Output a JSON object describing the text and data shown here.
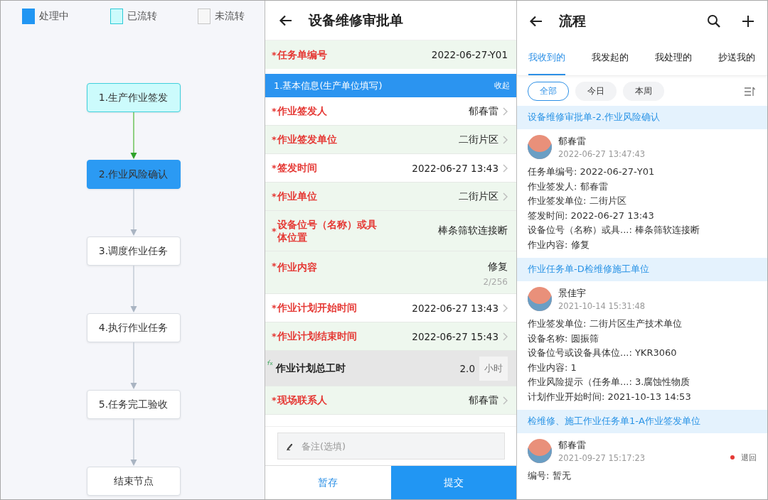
{
  "flow": {
    "legend": [
      {
        "label": "处理中",
        "kind": "active"
      },
      {
        "label": "已流转",
        "kind": "done"
      },
      {
        "label": "未流转",
        "kind": "pending"
      }
    ],
    "nodes": [
      {
        "label": "1.生产作业签发",
        "kind": "done"
      },
      {
        "label": "2.作业风险确认",
        "kind": "active"
      },
      {
        "label": "3.调度作业任务",
        "kind": "pending"
      },
      {
        "label": "4.执行作业任务",
        "kind": "pending"
      },
      {
        "label": "5.任务完工验收",
        "kind": "pending"
      },
      {
        "label": "结束节点",
        "kind": "pending"
      }
    ]
  },
  "form": {
    "title": "设备维修审批单",
    "task_number": {
      "marker": "*",
      "label": "任务单编号",
      "value": "2022-06-27-Y01"
    },
    "section": {
      "title": "1.基本信息(生产单位填写)",
      "action": "收起"
    },
    "fields": [
      {
        "kind": "select",
        "marker": "*",
        "label": "作业签发人",
        "value": "郁春雷",
        "shaded": false
      },
      {
        "kind": "select",
        "marker": "*",
        "label": "作业签发单位",
        "value": "二街片区",
        "shaded": true
      },
      {
        "kind": "select",
        "marker": "*",
        "label": "签发时间",
        "value": "2022-06-27 13:43",
        "shaded": false
      },
      {
        "kind": "select",
        "marker": "*",
        "label": "作业单位",
        "value": "二街片区",
        "shaded": true
      },
      {
        "kind": "text",
        "marker": "*",
        "label": "设备位号（名称）或具体位置",
        "value": "棒条筛软连接断",
        "shaded": true
      },
      {
        "kind": "text",
        "marker": "*",
        "label": "作业内容",
        "value": "修复",
        "counter": "2/256",
        "shaded": true
      },
      {
        "kind": "select",
        "marker": "*",
        "label": "作业计划开始时间",
        "value": "2022-06-27 13:43",
        "shaded": false
      },
      {
        "kind": "select",
        "marker": "*",
        "label": "作业计划结束时间",
        "value": "2022-06-27 15:43",
        "shaded": true
      },
      {
        "kind": "formula",
        "label": "作业计划总工时",
        "value": "2.0",
        "unit": "小时"
      },
      {
        "kind": "select",
        "marker": "*",
        "label": "现场联系人",
        "value": "郁春雷",
        "shaded": true
      }
    ],
    "remark": {
      "placeholder": "备注(选填)"
    },
    "buttons": [
      {
        "label": "暂存",
        "kind": "secondary"
      },
      {
        "label": "提交",
        "kind": "primary"
      }
    ]
  },
  "process": {
    "title": "流程",
    "tabs": [
      {
        "label": "我收到的",
        "selected": true
      },
      {
        "label": "我发起的",
        "selected": false
      },
      {
        "label": "我处理的",
        "selected": false
      },
      {
        "label": "抄送我的",
        "selected": false
      }
    ],
    "filters": [
      {
        "label": "全部",
        "selected": true
      },
      {
        "label": "今日",
        "selected": false
      },
      {
        "label": "本周",
        "selected": false
      }
    ],
    "items": [
      {
        "group": "设备维修审批单-2.作业风险确认",
        "name": "郁春雷",
        "time": "2022-06-27 13:47:43",
        "lines": [
          "任务单编号: 2022-06-27-Y01",
          "作业签发人: 郁春雷",
          "作业签发单位: 二街片区",
          "签发时间: 2022-06-27 13:43",
          "设备位号（名称）或具...: 棒条筛软连接断",
          "作业内容: 修复"
        ]
      },
      {
        "group": "作业任务单-D检维修施工单位",
        "name": "景佳宇",
        "time": "2021-10-14 15:31:48",
        "lines": [
          "作业签发单位: 二街片区生产技术单位",
          "设备名称: 圆振筛",
          "设备位号或设备具体位...: YKR3060",
          "作业内容: 1",
          "作业风险提示（任务单...: 3.腐蚀性物质",
          "计划作业开始时间: 2021-10-13 14:53"
        ]
      },
      {
        "group": "检维修、施工作业任务单1-A作业签发单位",
        "name": "郁春雷",
        "time": "2021-09-27 15:17:23",
        "status": {
          "label": "退回",
          "color": "#e53935"
        },
        "lines": [
          "编号: 暂无"
        ]
      }
    ]
  }
}
